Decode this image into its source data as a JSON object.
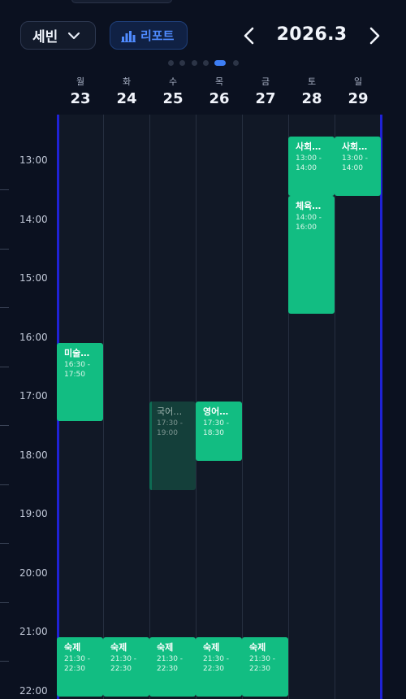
{
  "header": {
    "user_name": "세빈",
    "report_label": "리포트",
    "month_label": "2026.3"
  },
  "pager": {
    "count": 7,
    "active_index": 5
  },
  "days": [
    {
      "weekday": "월",
      "date": "23"
    },
    {
      "weekday": "화",
      "date": "24"
    },
    {
      "weekday": "수",
      "date": "25"
    },
    {
      "weekday": "목",
      "date": "26"
    },
    {
      "weekday": "금",
      "date": "27"
    },
    {
      "weekday": "토",
      "date": "28"
    },
    {
      "weekday": "일",
      "date": "29"
    }
  ],
  "hours": [
    "13:00",
    "14:00",
    "15:00",
    "16:00",
    "17:00",
    "18:00",
    "19:00",
    "20:00",
    "21:00",
    "22:00"
  ],
  "events": [
    {
      "title": "사회…",
      "range": "13:00 -\n14:00",
      "day": 5
    },
    {
      "title": "사회…",
      "range": "13:00 -\n14:00",
      "day": 6
    },
    {
      "title": "체육…",
      "range": "14:00 -\n16:00",
      "day": 5
    },
    {
      "title": "미술…",
      "range": "16:30 -\n17:50",
      "day": 0
    },
    {
      "title": "국어…",
      "range": "17:30 -\n19:00",
      "day": 2,
      "dimmed": true
    },
    {
      "title": "영어…",
      "range": "17:30 -\n18:30",
      "day": 3
    },
    {
      "title": "숙제",
      "range": "21:30 -\n22:30",
      "day": 0
    },
    {
      "title": "숙제",
      "range": "21:30 -\n22:30",
      "day": 1
    },
    {
      "title": "숙제",
      "range": "21:30 -\n22:30",
      "day": 2
    },
    {
      "title": "숙제",
      "range": "21:30 -\n22:30",
      "day": 3
    },
    {
      "title": "숙제",
      "range": "21:30 -\n22:30",
      "day": 4
    }
  ],
  "colors": {
    "event": "#12bd82",
    "event_dimmed": "#143f3a",
    "accent": "#3d7ef5",
    "edge": "#1f22d6"
  },
  "icons": {
    "dropdown": "chevron-down-icon",
    "report": "bar-chart-icon",
    "prev": "chevron-left-icon",
    "next": "chevron-right-icon"
  }
}
